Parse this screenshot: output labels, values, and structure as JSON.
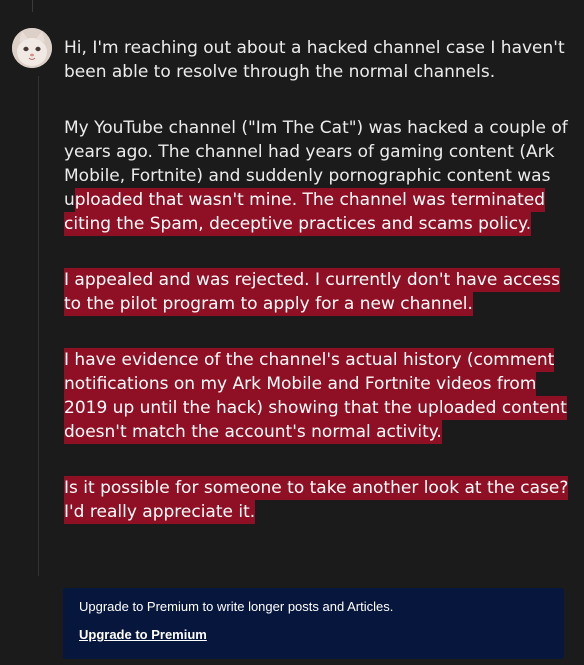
{
  "post": {
    "intro": "Hi, I'm reaching out about a hacked channel case I haven't been able to resolve through the normal channels.",
    "p2_plain": "My YouTube channel (\"Im The Cat\") was hacked a couple of years ago. The channel had years of gaming content (Ark Mobile, Fortnite) and suddenly pornographic content was u",
    "p2_highlight": "ploaded that wasn't mine. The channel was terminated citing the Spam, deceptive practices and scams policy.",
    "p3": "I appealed and was rejected. I currently don't have access to the pilot program to apply for a new channel.",
    "p4": "I have evidence of the channel's actual history (comment notifications on my Ark Mobile and Fortnite videos from 2019 up until the hack) showing that the uploaded content doesn't match the account's normal activity.",
    "p5": "Is it possible for someone to take another look at the case? I'd really appreciate it."
  },
  "premium": {
    "text": "Upgrade to Premium to write longer posts and Articles.",
    "link": "Upgrade to Premium"
  },
  "colors": {
    "highlight": "#8f1024",
    "premium_bg": "#07163d",
    "page_bg": "#1b1b1b"
  }
}
